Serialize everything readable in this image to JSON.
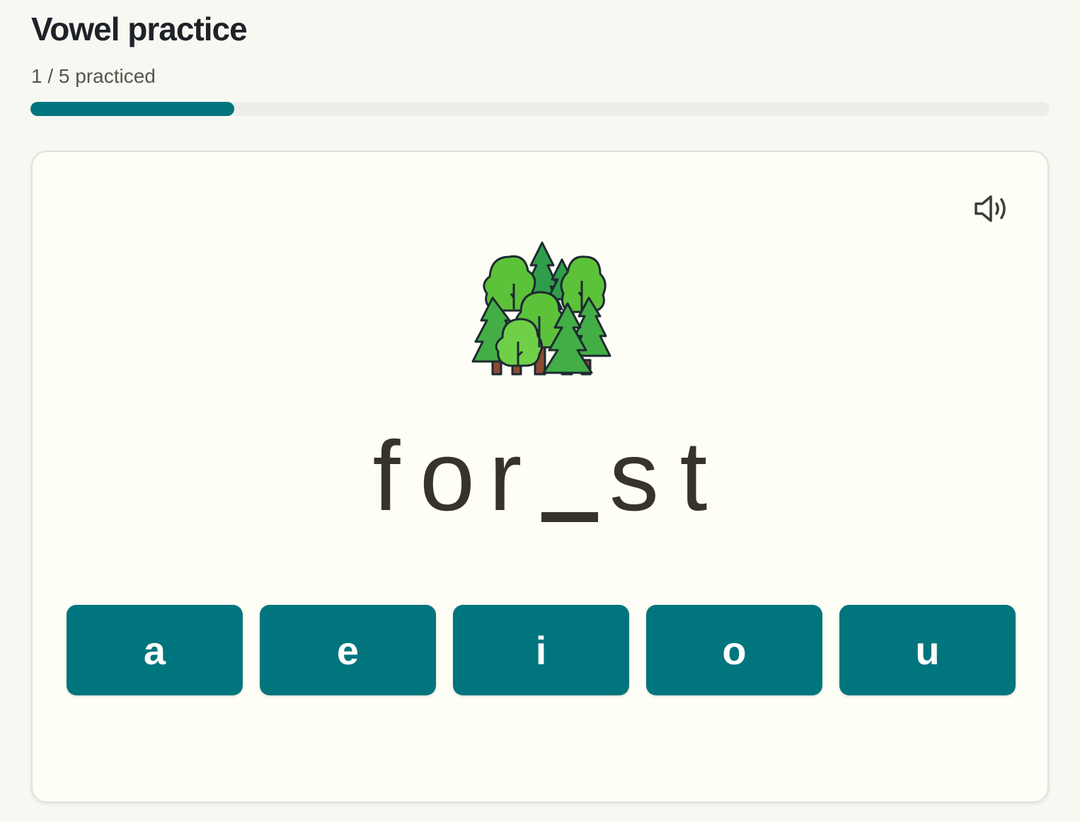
{
  "header": {
    "title": "Vowel practice",
    "progress_text": "1 / 5 practiced",
    "progress_fraction": 0.2,
    "accent_color": "#01757d"
  },
  "card": {
    "speaker_icon": "speaker-volume-icon",
    "illustration_icon": "forest-trees-icon",
    "word_letters": [
      "f",
      "o",
      "r",
      "_",
      "s",
      "t"
    ],
    "choices": [
      "a",
      "e",
      "i",
      "o",
      "u"
    ]
  }
}
